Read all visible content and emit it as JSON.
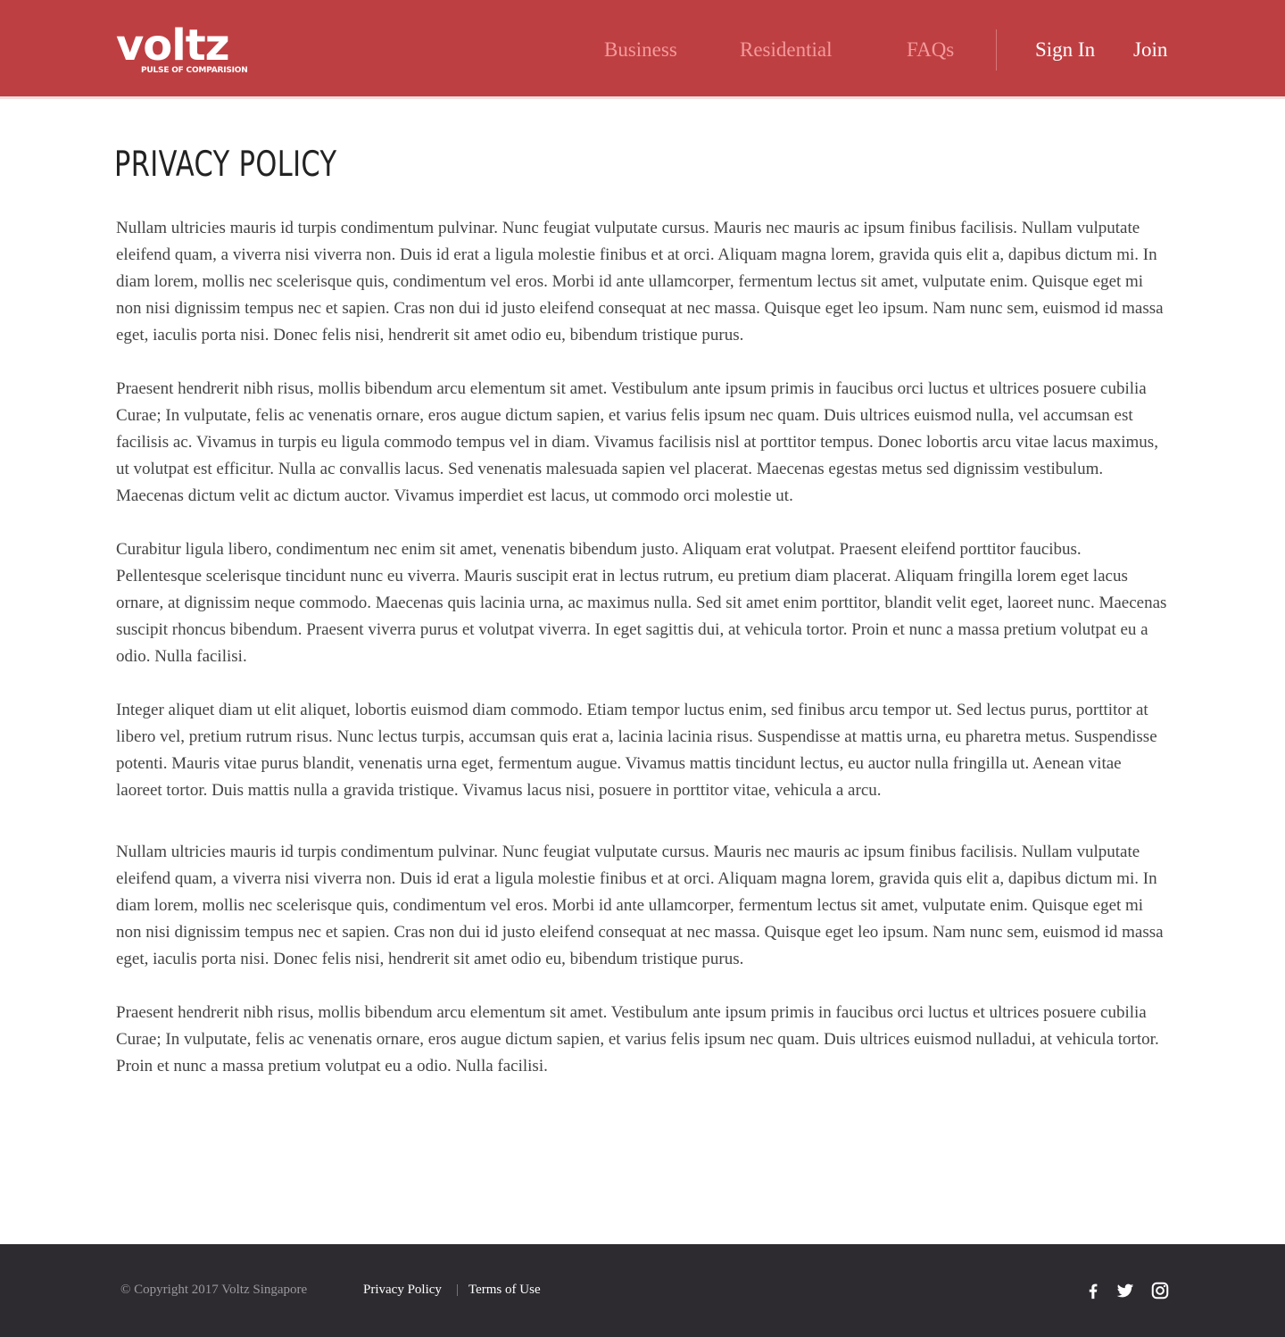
{
  "header": {
    "logo": {
      "word": "voltz",
      "tagline": "PULSE OF COMPARISION"
    },
    "nav": [
      {
        "label": "Business"
      },
      {
        "label": "Residential"
      },
      {
        "label": "FAQs"
      }
    ],
    "auth": {
      "sign_in": "Sign In",
      "join": "Join"
    }
  },
  "main": {
    "title": "PRIVACY POLICY",
    "paragraphs": [
      "Nullam ultricies mauris id turpis condimentum pulvinar. Nunc feugiat vulputate cursus. Mauris nec mauris ac ipsum finibus facilisis. Nullam vulputate eleifend quam, a viverra nisi viverra non. Duis id erat a ligula molestie finibus et at orci. Aliquam magna lorem, gravida quis elit a, dapibus dictum mi. In diam lorem, mollis nec scelerisque quis, condimentum vel eros. Morbi id ante ullamcorper, fermentum lectus sit amet, vulputate enim. Quisque eget mi non nisi dignissim tempus nec et sapien. Cras non dui id justo eleifend consequat at nec massa. Quisque eget leo ipsum. Nam nunc sem, euismod id massa eget, iaculis porta nisi. Donec felis nisi, hendrerit sit amet odio eu, bibendum tristique purus.",
      "Praesent hendrerit nibh risus, mollis bibendum arcu elementum sit amet. Vestibulum ante ipsum primis in faucibus orci luctus et ultrices posuere cubilia Curae; In vulputate, felis ac venenatis ornare, eros augue dictum sapien, et varius felis ipsum nec quam. Duis ultrices euismod nulla, vel accumsan est facilisis ac. Vivamus in turpis eu ligula commodo tempus vel in diam. Vivamus facilisis nisl at porttitor tempus. Donec lobortis arcu vitae lacus maximus, ut volutpat est efficitur. Nulla ac convallis lacus. Sed venenatis malesuada sapien vel placerat. Maecenas egestas metus sed dignissim vestibulum. Maecenas dictum velit ac dictum auctor. Vivamus imperdiet est lacus, ut commodo orci molestie ut.",
      "Curabitur ligula libero, condimentum nec enim sit amet, venenatis bibendum justo. Aliquam erat volutpat. Praesent eleifend porttitor faucibus. Pellentesque scelerisque tincidunt nunc eu viverra. Mauris suscipit erat in lectus rutrum, eu pretium diam placerat. Aliquam fringilla lorem eget lacus ornare, at dignissim neque commodo. Maecenas quis lacinia urna, ac maximus nulla. Sed sit amet enim porttitor, blandit velit eget, laoreet nunc. Maecenas suscipit rhoncus bibendum. Praesent viverra purus et volutpat viverra. In eget sagittis dui, at vehicula tortor. Proin et nunc a massa pretium volutpat eu a odio. Nulla facilisi.",
      "Integer aliquet diam ut elit aliquet, lobortis euismod diam commodo. Etiam tempor luctus enim, sed finibus arcu tempor ut. Sed lectus purus, porttitor at libero vel, pretium rutrum risus. Nunc lectus turpis, accumsan quis erat a, lacinia lacinia risus. Suspendisse at mattis urna, eu pharetra metus. Suspendisse potenti. Mauris vitae purus blandit, venenatis urna eget, fermentum augue. Vivamus mattis tincidunt lectus, eu auctor nulla fringilla ut. Aenean vitae laoreet tortor. Duis mattis nulla a gravida tristique. Vivamus lacus nisi, posuere in porttitor vitae, vehicula a arcu.",
      "Nullam ultricies mauris id turpis condimentum pulvinar. Nunc feugiat vulputate cursus. Mauris nec mauris ac ipsum finibus facilisis. Nullam vulputate eleifend quam, a viverra nisi viverra non. Duis id erat a ligula molestie finibus et at orci. Aliquam magna lorem, gravida quis elit a, dapibus dictum mi. In diam lorem, mollis nec scelerisque quis, condimentum vel eros. Morbi id ante ullamcorper, fermentum lectus sit amet, vulputate enim. Quisque eget mi non nisi dignissim tempus nec et sapien. Cras non dui id justo eleifend consequat at nec massa. Quisque eget leo ipsum. Nam nunc sem, euismod id massa eget, iaculis porta nisi. Donec felis nisi, hendrerit sit amet odio eu, bibendum tristique purus.",
      "Praesent hendrerit nibh risus, mollis bibendum arcu elementum sit amet. Vestibulum ante ipsum primis in faucibus orci luctus et ultrices posuere cubilia Curae; In vulputate, felis ac venenatis ornare, eros augue dictum sapien, et varius felis ipsum nec quam. Duis ultrices euismod nulladui, at vehicula tortor. Proin et nunc a massa pretium volutpat eu a odio. Nulla facilisi."
    ]
  },
  "footer": {
    "copyright": "© Copyright 2017 Voltz Singapore",
    "links": {
      "privacy": "Privacy Policy",
      "separator": "|",
      "terms": "Terms of Use"
    },
    "social": [
      {
        "icon": "facebook-icon"
      },
      {
        "icon": "twitter-icon"
      },
      {
        "icon": "instagram-icon"
      }
    ]
  },
  "colors": {
    "header_bg": "#be3f42",
    "nav_link": "#f49a9b",
    "footer_bg": "#2d2b30",
    "body_text": "#444444"
  }
}
